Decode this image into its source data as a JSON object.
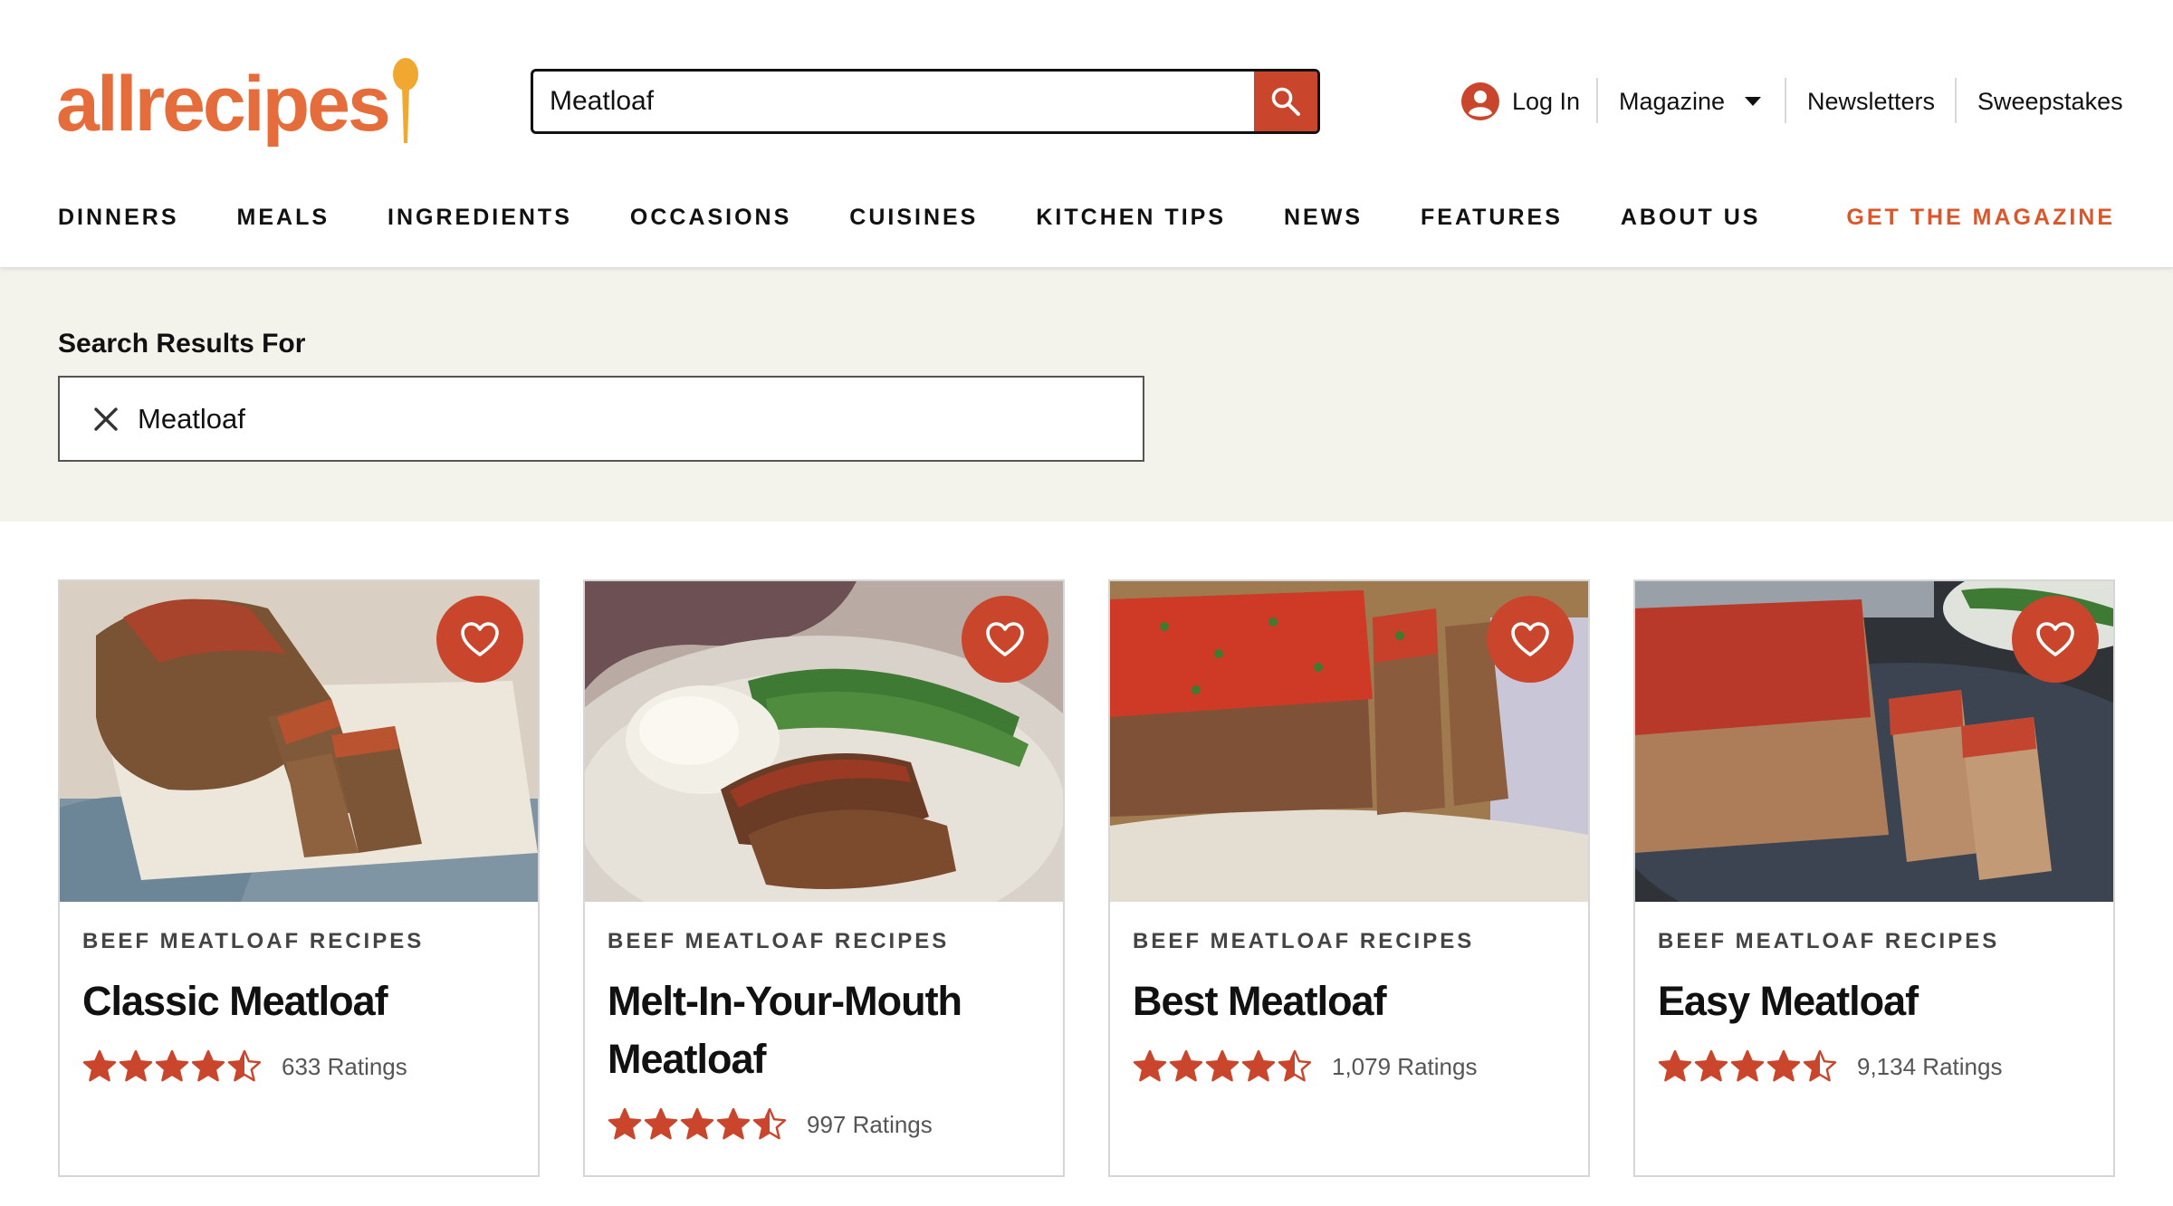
{
  "header": {
    "logo": "allrecipes",
    "search": {
      "value": "Meatloaf",
      "placeholder": ""
    },
    "utility": {
      "login": "Log In",
      "magazine": "Magazine",
      "newsletters": "Newsletters",
      "sweepstakes": "Sweepstakes"
    },
    "nav": [
      "DINNERS",
      "MEALS",
      "INGREDIENTS",
      "OCCASIONS",
      "CUISINES",
      "KITCHEN TIPS",
      "NEWS",
      "FEATURES",
      "ABOUT US"
    ],
    "cta": "GET THE MAGAZINE"
  },
  "results": {
    "heading": "Search Results For",
    "term": "Meatloaf"
  },
  "cards": [
    {
      "category": "BEEF MEATLOAF RECIPES",
      "title": "Classic Meatloaf",
      "rating": 4.5,
      "ratings_text": "633 Ratings"
    },
    {
      "category": "BEEF MEATLOAF RECIPES",
      "title": "Melt-In-Your-Mouth Meatloaf",
      "rating": 4.5,
      "ratings_text": "997 Ratings"
    },
    {
      "category": "BEEF MEATLOAF RECIPES",
      "title": "Best Meatloaf",
      "rating": 4.5,
      "ratings_text": "1,079 Ratings"
    },
    {
      "category": "BEEF MEATLOAF RECIPES",
      "title": "Easy Meatloaf",
      "rating": 4.5,
      "ratings_text": "9,134 Ratings"
    }
  ],
  "icons": {
    "search": "search-icon",
    "user": "user-icon",
    "caret": "chevron-down-icon",
    "clear": "close-icon",
    "heart": "heart-icon",
    "star": "star-icon"
  },
  "colors": {
    "brand": "#e56d3c",
    "accent": "#c9462c",
    "cta": "#d9572b",
    "band": "#f3f3ec",
    "star": "#c9462c"
  }
}
